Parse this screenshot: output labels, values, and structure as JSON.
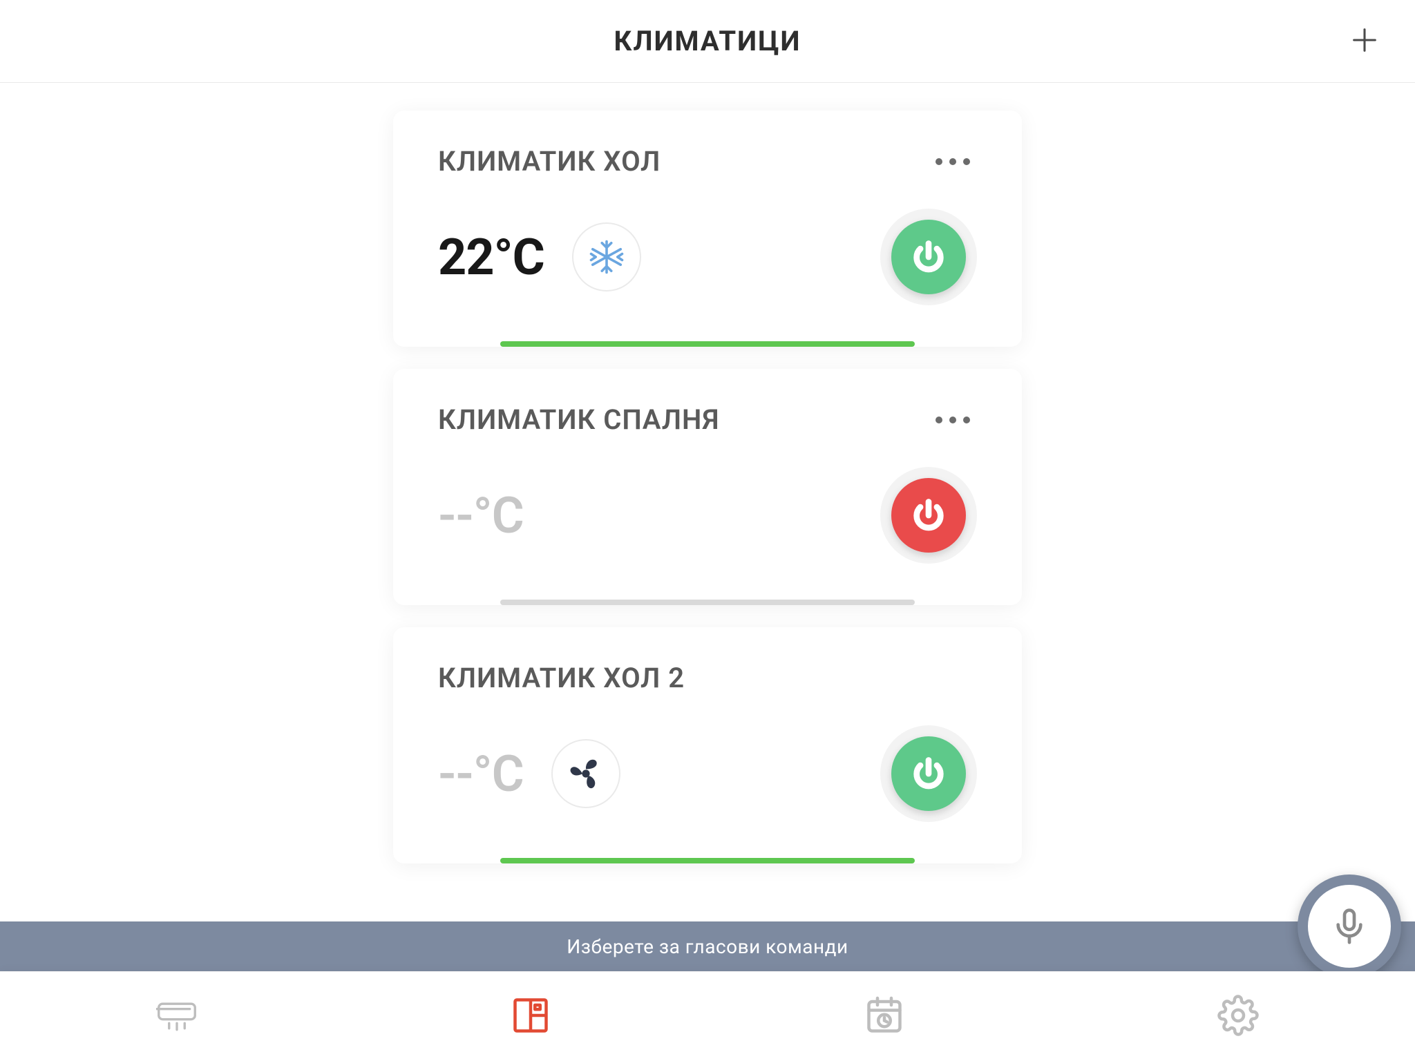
{
  "header": {
    "title": "КЛИМАТИЦИ"
  },
  "devices": [
    {
      "name": "КЛИМАТИК ХОЛ",
      "temperature": "22°C",
      "temp_known": true,
      "mode_icon": "snowflake-icon",
      "power_on": true,
      "progress_pct": 100,
      "has_more": true
    },
    {
      "name": "КЛИМАТИК СПАЛНЯ",
      "temperature": "--°C",
      "temp_known": false,
      "mode_icon": null,
      "power_on": false,
      "progress_pct": 0,
      "has_more": true
    },
    {
      "name": "КЛИМАТИК ХОЛ 2",
      "temperature": "--°C",
      "temp_known": false,
      "mode_icon": "fan-icon",
      "power_on": true,
      "progress_pct": 100,
      "has_more": false
    }
  ],
  "voice_bar": {
    "text": "Изберете за гласови команди"
  },
  "nav": {
    "items": [
      "ac-unit",
      "rooms",
      "schedule",
      "settings"
    ],
    "active_index": 1
  },
  "colors": {
    "power_on": "#5ec98a",
    "power_off": "#e94b4b",
    "progress": "#5ec750",
    "accent": "#e24a33",
    "voice_bar": "#7d8aa0"
  }
}
